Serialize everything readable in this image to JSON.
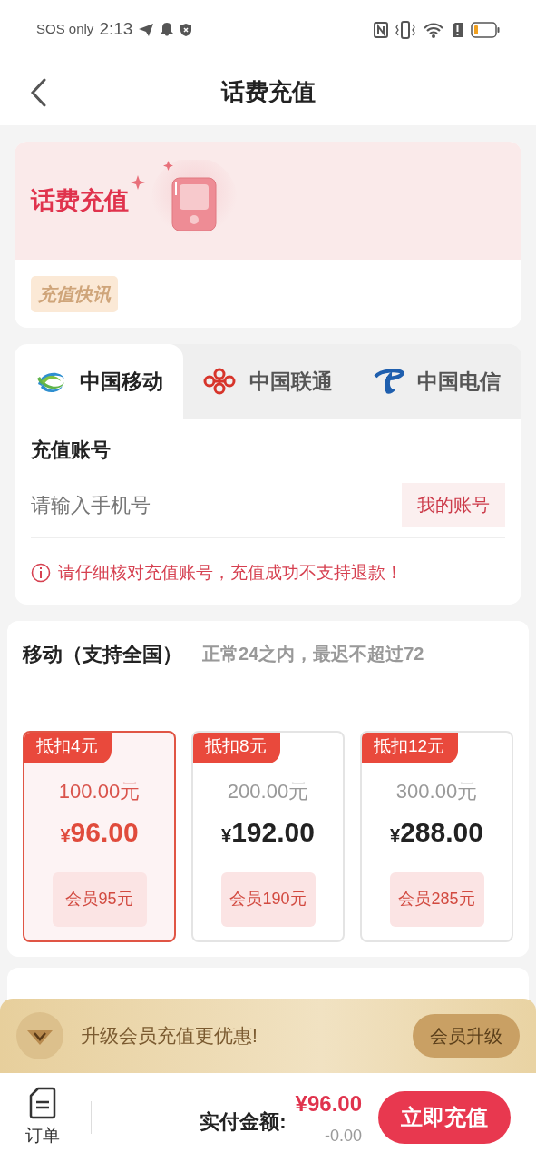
{
  "status_bar": {
    "carrier": "SOS only",
    "time": "2:13"
  },
  "header": {
    "title": "话费充值"
  },
  "banner": {
    "title": "话费充值",
    "news_tag": "充值快讯"
  },
  "carrier_tabs": [
    {
      "label": "中国移动",
      "kind": "mobile",
      "selected": true
    },
    {
      "label": "中国联通",
      "kind": "unicom",
      "selected": false
    },
    {
      "label": "中国电信",
      "kind": "telecom",
      "selected": false
    }
  ],
  "account": {
    "label": "充值账号",
    "placeholder": "请输入手机号",
    "my_account_button": "我的账号",
    "warning": "请仔细核对充值账号，充值成功不支持退款！"
  },
  "packages": {
    "title": "移动（支持全国）",
    "note": "正常24之内，最迟不超过72",
    "options": [
      {
        "discount_tag": "抵扣4元",
        "face_value": "100.00元",
        "currency": "¥",
        "price": "96.00",
        "member_price": "会员95元",
        "selected": true
      },
      {
        "discount_tag": "抵扣8元",
        "face_value": "200.00元",
        "currency": "¥",
        "price": "192.00",
        "member_price": "会员190元",
        "selected": false
      },
      {
        "discount_tag": "抵扣12元",
        "face_value": "300.00元",
        "currency": "¥",
        "price": "288.00",
        "member_price": "会员285元",
        "selected": false
      }
    ]
  },
  "upgrade": {
    "text": "升级会员充值更优惠!",
    "button": "会员升级"
  },
  "footer": {
    "orders_label": "订单",
    "total_label": "实付金额:",
    "total": "¥96.00",
    "discount": "-0.00",
    "pay_button": "立即充值"
  }
}
